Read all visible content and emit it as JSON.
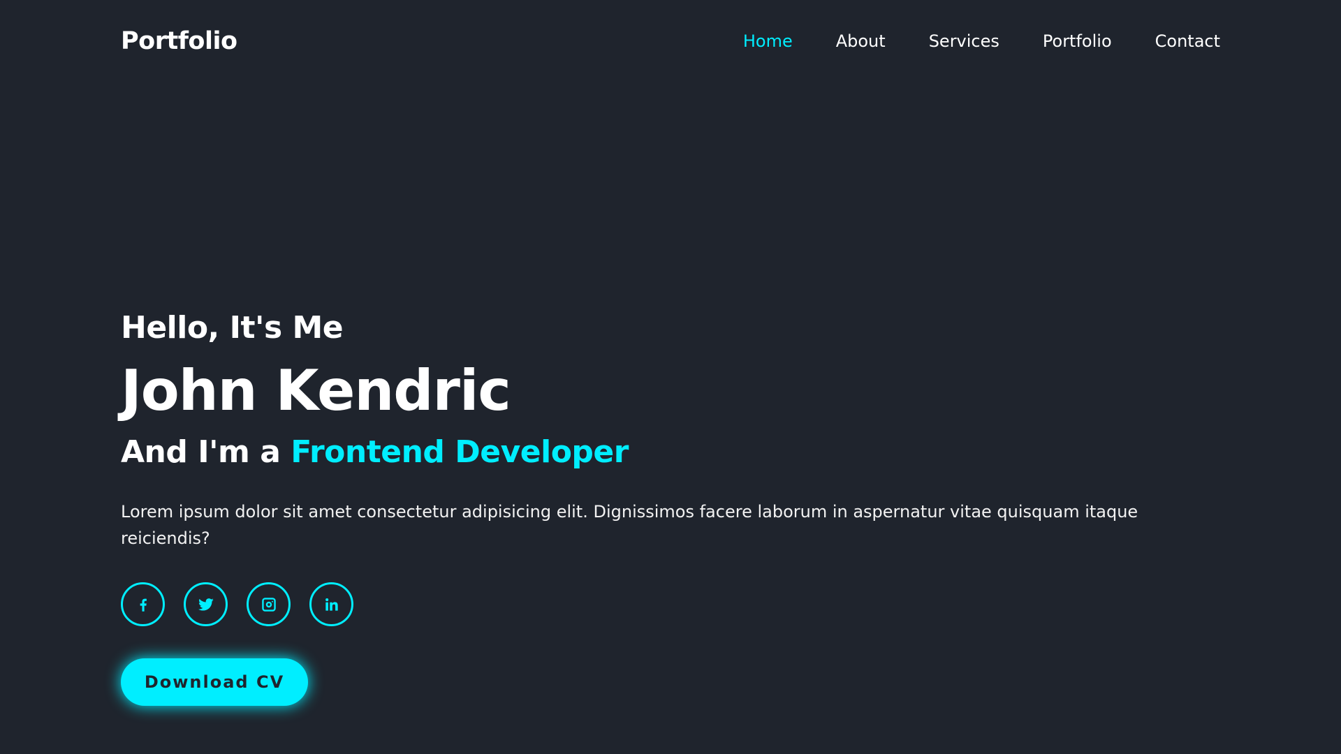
{
  "header": {
    "logo": "Portfolio",
    "nav": [
      {
        "label": "Home",
        "active": true
      },
      {
        "label": "About",
        "active": false
      },
      {
        "label": "Services",
        "active": false
      },
      {
        "label": "Portfolio",
        "active": false
      },
      {
        "label": "Contact",
        "active": false
      }
    ]
  },
  "hero": {
    "greeting": "Hello, It's Me",
    "name": "John Kendric",
    "role_prefix": "And I'm a",
    "role_highlight": "Frontend Developer",
    "description": "Lorem ipsum dolor sit amet consectetur adipisicing elit. Dignissimos facere laborum in aspernatur vitae quisquam itaque reiciendis?",
    "social": [
      {
        "icon": "facebook-icon"
      },
      {
        "icon": "twitter-icon"
      },
      {
        "icon": "instagram-icon"
      },
      {
        "icon": "linkedin-icon"
      }
    ],
    "cta_label": "Download CV"
  },
  "colors": {
    "background": "#1f242d",
    "accent": "#00eeff",
    "text": "#ffffff"
  }
}
